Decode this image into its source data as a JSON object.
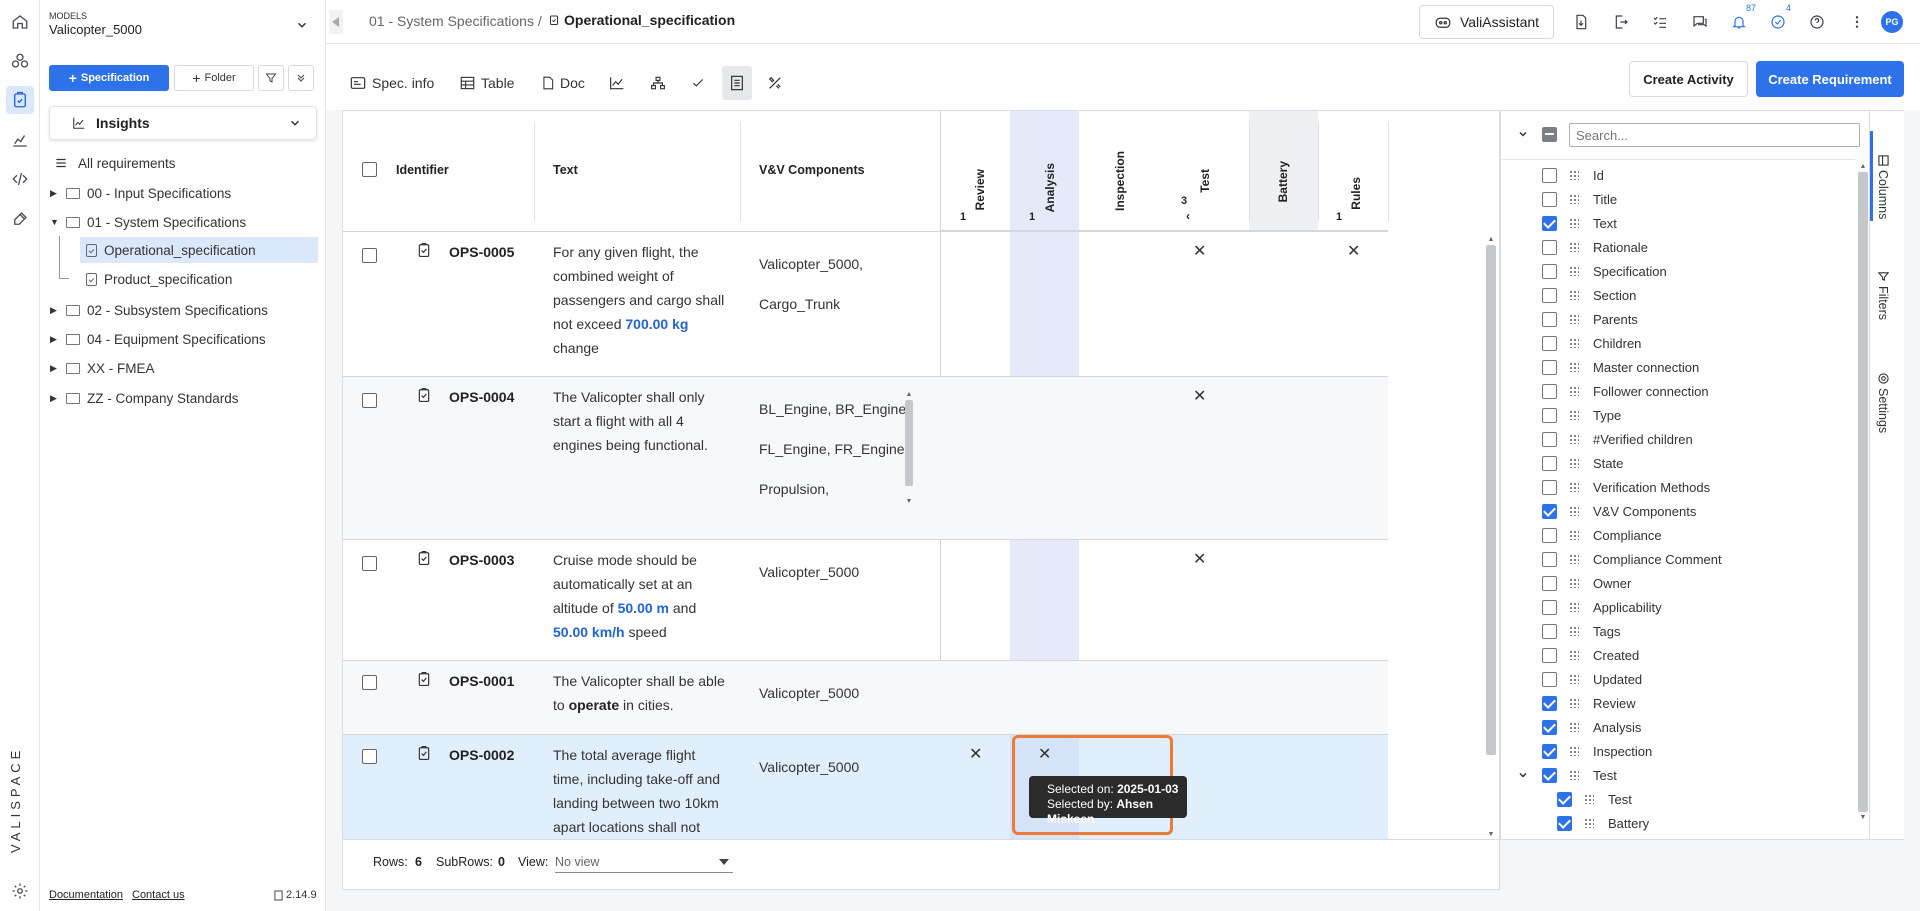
{
  "models": {
    "label": "MODELS",
    "value": "Valicopter_5000"
  },
  "sidebar": {
    "spec_button": "Specification",
    "folder_button": "Folder",
    "insights_label": "Insights",
    "all_requirements": "All requirements",
    "tree": [
      {
        "label": "00 - Input Specifications"
      },
      {
        "label": "01 - System Specifications"
      },
      {
        "label": "Operational_specification"
      },
      {
        "label": "Product_specification"
      },
      {
        "label": "02 - Subsystem Specifications"
      },
      {
        "label": "04 - Equipment Specifications"
      },
      {
        "label": "XX - FMEA"
      },
      {
        "label": "ZZ - Company Standards"
      }
    ],
    "footer": {
      "documentation": "Documentation",
      "contact": "Contact us",
      "version": "2.14.9"
    }
  },
  "logo": "VALISPACE",
  "topbar": {
    "breadcrumb_parent": "01 - System Specifications /",
    "breadcrumb_current": "Operational_specification",
    "assistant": "ValiAssistant",
    "notif_count": "87",
    "tasks_count": "4",
    "avatar": "PG"
  },
  "toolbar": {
    "spec_info": "Spec. info",
    "table": "Table",
    "doc": "Doc",
    "create_activity": "Create Activity",
    "create_requirement": "Create Requirement"
  },
  "table": {
    "headers": {
      "identifier": "Identifier",
      "text": "Text",
      "vv": "V&V Components"
    },
    "vcols": [
      {
        "label": "Review",
        "count": "1"
      },
      {
        "label": "Analysis",
        "count": "1"
      },
      {
        "label": "Inspection",
        "count": ""
      },
      {
        "label": "Test",
        "count": "3"
      },
      {
        "label": "Battery",
        "count": ""
      },
      {
        "label": "Rules",
        "count": "1"
      }
    ],
    "rows": [
      {
        "id": "OPS-0005",
        "text_lines": [
          "For any given flight, the",
          "combined weight of",
          "passengers and cargo shall",
          "not exceed ",
          "change"
        ],
        "highlight": "700.00  kg",
        "vv": [
          "Valicopter_5000,",
          "Cargo_Trunk"
        ]
      },
      {
        "id": "OPS-0004",
        "text_lines": [
          "The Valicopter shall only",
          "start a flight with all 4",
          "engines being functional."
        ],
        "vv": [
          "BL_Engine, BR_Engine,",
          "FL_Engine, FR_Engine,",
          "Propulsion,"
        ]
      },
      {
        "id": "OPS-0003",
        "text_lines": [
          "Cruise mode should be",
          "automatically set at an",
          "altitude of ",
          " and",
          " speed"
        ],
        "hl1": "50.00  m",
        "hl2": "50.00  km/h",
        "vv": [
          "Valicopter_5000"
        ]
      },
      {
        "id": "OPS-0001",
        "text_lines": [
          "The Valicopter shall be able",
          "to ",
          " in cities."
        ],
        "bold_word": "operate",
        "vv": [
          "Valicopter_5000"
        ]
      },
      {
        "id": "OPS-0002",
        "text_lines": [
          "The total average flight",
          "time, including take-off and",
          "landing between two 10km",
          "apart locations shall not"
        ],
        "vv": [
          "Valicopter_5000"
        ]
      }
    ],
    "tooltip": {
      "selected_on_label": "Selected on: ",
      "selected_on": "2025-01-03",
      "selected_by_label": "Selected by: ",
      "selected_by": "Ahsen Miskeen"
    }
  },
  "footer_bar": {
    "rows_label": "Rows:",
    "rows": "6",
    "subrows_label": "SubRows:",
    "subrows": "0",
    "view_label": "View:",
    "view_value": "No view"
  },
  "columns_panel": {
    "search_placeholder": "Search...",
    "items": [
      {
        "label": "Id",
        "checked": false
      },
      {
        "label": "Title",
        "checked": false
      },
      {
        "label": "Text",
        "checked": true
      },
      {
        "label": "Rationale",
        "checked": false
      },
      {
        "label": "Specification",
        "checked": false
      },
      {
        "label": "Section",
        "checked": false
      },
      {
        "label": "Parents",
        "checked": false
      },
      {
        "label": "Children",
        "checked": false
      },
      {
        "label": "Master connection",
        "checked": false
      },
      {
        "label": "Follower connection",
        "checked": false
      },
      {
        "label": "Type",
        "checked": false
      },
      {
        "label": "#Verified children",
        "checked": false
      },
      {
        "label": "State",
        "checked": false
      },
      {
        "label": "Verification Methods",
        "checked": false
      },
      {
        "label": "V&V Components",
        "checked": true
      },
      {
        "label": "Compliance",
        "checked": false
      },
      {
        "label": "Compliance Comment",
        "checked": false
      },
      {
        "label": "Owner",
        "checked": false
      },
      {
        "label": "Applicability",
        "checked": false
      },
      {
        "label": "Tags",
        "checked": false
      },
      {
        "label": "Created",
        "checked": false
      },
      {
        "label": "Updated",
        "checked": false
      },
      {
        "label": "Review",
        "checked": true
      },
      {
        "label": "Analysis",
        "checked": true
      },
      {
        "label": "Inspection",
        "checked": true
      },
      {
        "label": "Test",
        "checked": true
      },
      {
        "label": "Test",
        "checked": true
      },
      {
        "label": "Battery",
        "checked": true
      }
    ],
    "tabs": [
      "Columns",
      "Filters",
      "Settings"
    ]
  },
  "colors": {
    "accent": "#2d72e8",
    "highlight_row": "#e1eefc",
    "analysis_col": "#e4eaf7",
    "tooltip_border": "#ef7a35"
  }
}
